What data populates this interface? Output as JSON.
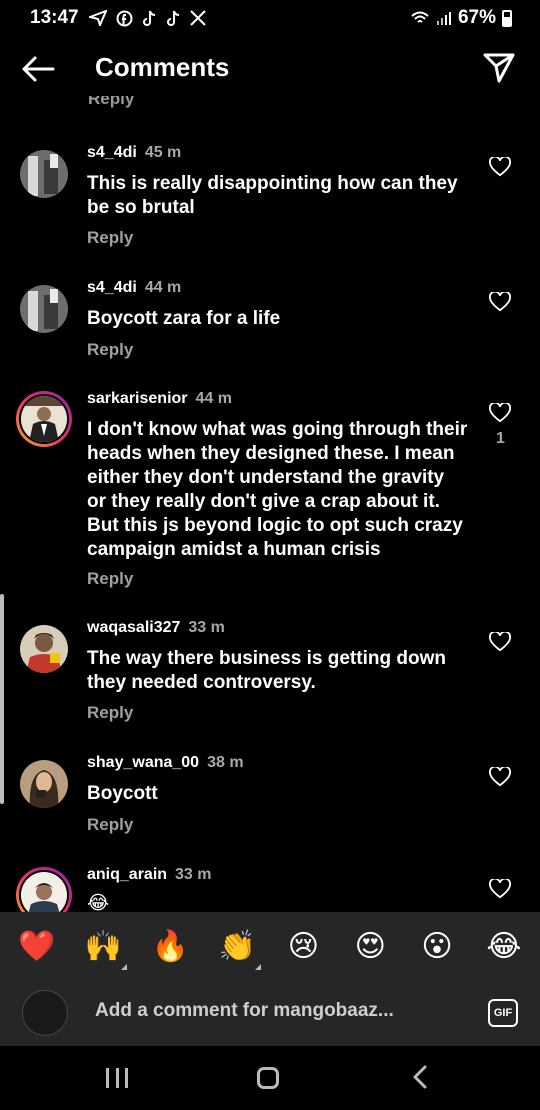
{
  "status_bar": {
    "time": "13:47",
    "icons": [
      "navigation-icon",
      "facebook-icon",
      "tiktok-icon",
      "tiktok-icon",
      "x-icon"
    ],
    "battery": "67%"
  },
  "header": {
    "title": "Comments"
  },
  "partial_reply": "Reply",
  "comments": [
    {
      "user": "s4_4di",
      "time": "45 m",
      "text": [
        "This is really disappointing how can they",
        "be so brutal"
      ],
      "reply": "Reply",
      "likes": ""
    },
    {
      "user": "s4_4di",
      "time": "44 m",
      "text": [
        "Boycott zara for a life"
      ],
      "reply": "Reply",
      "likes": ""
    },
    {
      "user": "sarkarisenior",
      "time": "44 m",
      "text": [
        "I don't know what was going through their",
        "heads when they designed these. I mean",
        "either they don't understand the gravity",
        "or they really don't give a crap about it.",
        "But this js beyond logic to opt such crazy",
        "campaign amidst a human crisis"
      ],
      "reply": "Reply",
      "likes": "1"
    },
    {
      "user": "waqasali327",
      "time": "33 m",
      "text": [
        "The way there business is getting down",
        "they needed controversy."
      ],
      "reply": "Reply",
      "likes": ""
    },
    {
      "user": "shay_wana_00",
      "time": "38 m",
      "text": [
        "Boycott"
      ],
      "reply": "Reply",
      "likes": ""
    },
    {
      "user": "aniq_arain",
      "time": "33 m",
      "text": [
        "😂"
      ],
      "reply": "",
      "likes": ""
    }
  ],
  "emoji_bar": [
    "❤️",
    "🙌",
    "🔥",
    "👏",
    "😢",
    "😍",
    "😮",
    "😂"
  ],
  "comment_input": {
    "placeholder": "Add a comment for mangobaaz...",
    "gif_label": "GIF"
  }
}
